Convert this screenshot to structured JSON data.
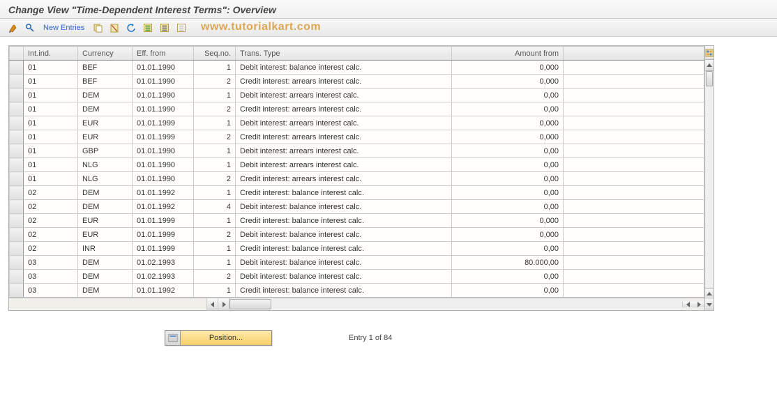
{
  "title": "Change View \"Time-Dependent Interest Terms\": Overview",
  "toolbar": {
    "new_entries": "New Entries"
  },
  "watermark": "www.tutorialkart.com",
  "table": {
    "headers": {
      "int": "Int.ind.",
      "currency": "Currency",
      "eff": "Eff. from",
      "seq": "Seq.no.",
      "type": "Trans. Type",
      "amount": "Amount from"
    },
    "rows": [
      {
        "int": "01",
        "currency": "BEF",
        "eff": "01.01.1990",
        "seq": "1",
        "type": "Debit interest: balance interest calc.",
        "amount": "0,000"
      },
      {
        "int": "01",
        "currency": "BEF",
        "eff": "01.01.1990",
        "seq": "2",
        "type": "Credit interest: arrears interest calc.",
        "amount": "0,000"
      },
      {
        "int": "01",
        "currency": "DEM",
        "eff": "01.01.1990",
        "seq": "1",
        "type": "Debit interest: arrears interest calc.",
        "amount": "0,00"
      },
      {
        "int": "01",
        "currency": "DEM",
        "eff": "01.01.1990",
        "seq": "2",
        "type": "Credit interest: arrears interest calc.",
        "amount": "0,00"
      },
      {
        "int": "01",
        "currency": "EUR",
        "eff": "01.01.1999",
        "seq": "1",
        "type": "Debit interest: arrears interest calc.",
        "amount": "0,000"
      },
      {
        "int": "01",
        "currency": "EUR",
        "eff": "01.01.1999",
        "seq": "2",
        "type": "Credit interest: arrears interest calc.",
        "amount": "0,000"
      },
      {
        "int": "01",
        "currency": "GBP",
        "eff": "01.01.1990",
        "seq": "1",
        "type": "Debit interest: arrears interest calc.",
        "amount": "0,00"
      },
      {
        "int": "01",
        "currency": "NLG",
        "eff": "01.01.1990",
        "seq": "1",
        "type": "Debit interest: arrears interest calc.",
        "amount": "0,00"
      },
      {
        "int": "01",
        "currency": "NLG",
        "eff": "01.01.1990",
        "seq": "2",
        "type": "Credit interest: arrears interest calc.",
        "amount": "0,00"
      },
      {
        "int": "02",
        "currency": "DEM",
        "eff": "01.01.1992",
        "seq": "1",
        "type": "Credit interest: balance interest calc.",
        "amount": "0,00"
      },
      {
        "int": "02",
        "currency": "DEM",
        "eff": "01.01.1992",
        "seq": "4",
        "type": "Debit interest: balance interest calc.",
        "amount": "0,00"
      },
      {
        "int": "02",
        "currency": "EUR",
        "eff": "01.01.1999",
        "seq": "1",
        "type": "Credit interest: balance interest calc.",
        "amount": "0,000"
      },
      {
        "int": "02",
        "currency": "EUR",
        "eff": "01.01.1999",
        "seq": "2",
        "type": "Debit interest: balance interest calc.",
        "amount": "0,000"
      },
      {
        "int": "02",
        "currency": "INR",
        "eff": "01.01.1999",
        "seq": "1",
        "type": "Credit interest: balance interest calc.",
        "amount": "0,00"
      },
      {
        "int": "03",
        "currency": "DEM",
        "eff": "01.02.1993",
        "seq": "1",
        "type": "Debit interest: balance interest calc.",
        "amount": "80.000,00"
      },
      {
        "int": "03",
        "currency": "DEM",
        "eff": "01.02.1993",
        "seq": "2",
        "type": "Debit interest: balance interest calc.",
        "amount": "0,00"
      },
      {
        "int": "03",
        "currency": "DEM",
        "eff": "01.01.1992",
        "seq": "1",
        "type": "Credit interest: balance interest calc.",
        "amount": "0,00"
      }
    ]
  },
  "footer": {
    "position_label": "Position...",
    "entry_info": "Entry 1 of 84"
  }
}
